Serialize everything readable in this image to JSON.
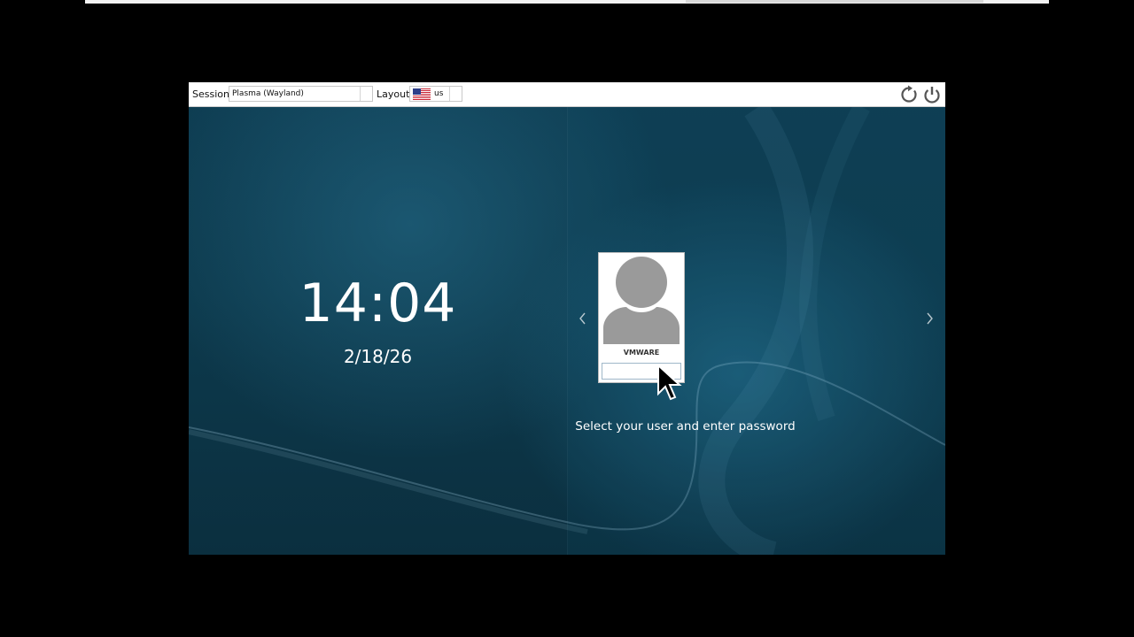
{
  "greeter_bar": {
    "session_label": "Session",
    "session_value": "Plasma (Wayland)",
    "layout_label": "Layout",
    "layout_value": "us"
  },
  "clock": {
    "time": "14:04",
    "date": "2/18/26"
  },
  "user": {
    "name": "VMWARE",
    "password_value": "",
    "password_placeholder": ""
  },
  "hint": "Select your user and enter password",
  "icons": {
    "reboot": "reboot-icon",
    "shutdown": "power-icon",
    "prev": "chevron-left-icon",
    "next": "chevron-right-icon",
    "avatar": "user-avatar-icon",
    "flag": "us-flag-icon"
  },
  "colors": {
    "background": "#0d3a4d",
    "bar": "#ffffff",
    "text": "#ffffff"
  }
}
